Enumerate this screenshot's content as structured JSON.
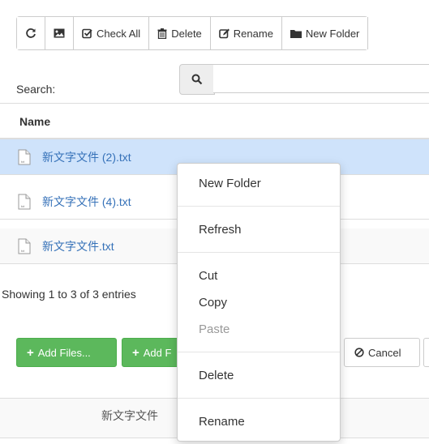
{
  "toolbar": {
    "refresh_icon": "refresh-icon",
    "image_icon": "image-icon",
    "check_all": "Check All",
    "delete": "Delete",
    "rename": "Rename",
    "new_folder": "New Folder"
  },
  "search": {
    "label": "Search:",
    "placeholder": "",
    "value": ""
  },
  "table": {
    "column_name": "Name",
    "rows": [
      {
        "name": "新文字文件 (2).txt",
        "selected": true
      },
      {
        "name": "新文字文件 (4).txt",
        "selected": false
      },
      {
        "name": "新文字文件.txt",
        "selected": false
      }
    ],
    "info": "Showing 1 to 3 of 3 entries"
  },
  "buttons": {
    "add_files": "Add Files...",
    "add_folder": "Add F",
    "cancel": "Cancel"
  },
  "upload": {
    "file_name": "新文字文件"
  },
  "context_menu": {
    "new_folder": "New Folder",
    "refresh": "Refresh",
    "cut": "Cut",
    "copy": "Copy",
    "paste": "Paste",
    "delete": "Delete",
    "rename": "Rename"
  },
  "colors": {
    "selected_row": "#cfe3fb",
    "link": "#3571b8",
    "success": "#5cb85c"
  }
}
